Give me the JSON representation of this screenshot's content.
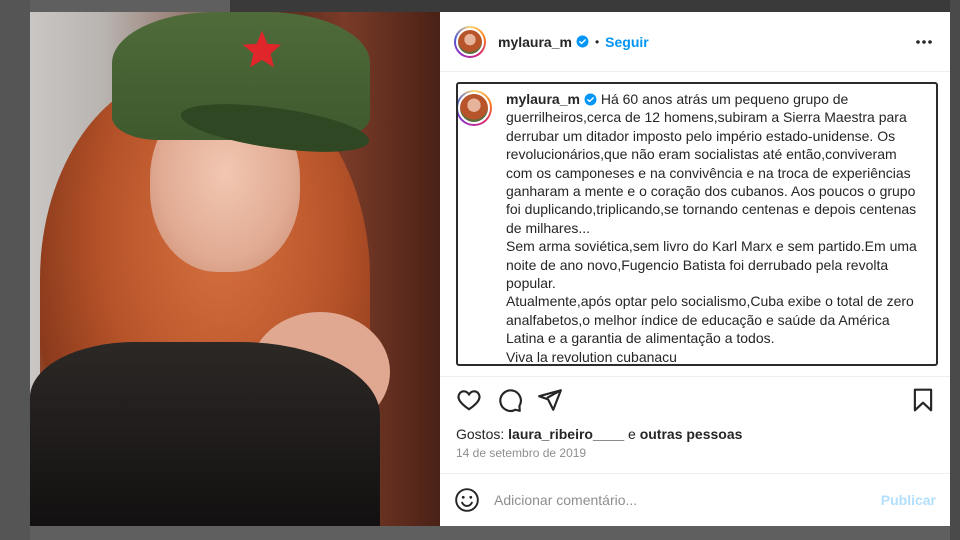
{
  "post": {
    "username": "mylaura_m",
    "follow_label": "Seguir",
    "separator": "•",
    "caption": "Há 60 anos atrás um pequeno grupo de guerrilheiros,cerca de 12 homens,subiram a Sierra Maestra para derrubar um ditador imposto pelo império estado-unidense. Os revolucionários,que não eram socialistas até então,conviveram com os camponeses e na convivência e na troca de experiências ganharam a mente e o coração dos cubanos. Aos poucos o grupo foi duplicando,triplicando,se tornando centenas e depois centenas de milhares...\nSem arma soviética,sem livro do Karl Marx e sem partido.Em uma noite de ano novo,Fugencio Batista foi derrubado pela revolta popular.\nAtualmente,após optar pelo socialismo,Cuba exibe o total de zero analfabetos,o melhor índice de educação e saúde da América Latina e a garantia de alimentação a todos.\nViva la revolution cubanacu",
    "likes_prefix": "Gostos:",
    "likes_user": "laura_ribeiro____",
    "likes_connector": "e",
    "likes_others": "outras pessoas",
    "date": "14 de setembro de 2019"
  },
  "comment": {
    "placeholder": "Adicionar comentário...",
    "publish_label": "Publicar"
  },
  "icons": {
    "verified": "verified-badge-icon",
    "more": "more-options-icon",
    "like": "heart-icon",
    "comment": "comment-bubble-icon",
    "share": "paper-plane-icon",
    "save": "bookmark-icon",
    "emoji": "emoji-smiley-icon"
  },
  "colors": {
    "accent": "#0095f6",
    "publish_disabled": "#b2dffc",
    "verified": "#0095f6",
    "star": "#e0262b"
  }
}
